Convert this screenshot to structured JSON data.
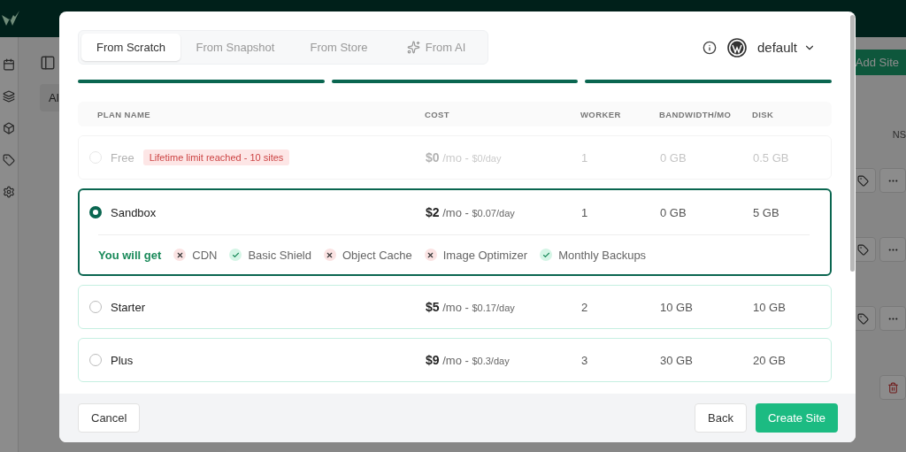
{
  "background": {
    "tab_label": "Al",
    "add_button": "Add Site",
    "column_header": "NS"
  },
  "modal": {
    "tabs": [
      {
        "label": "From Scratch",
        "selected": true
      },
      {
        "label": "From Snapshot",
        "selected": false
      },
      {
        "label": "From Store",
        "selected": false
      },
      {
        "label": "From AI",
        "selected": false
      }
    ],
    "profile": {
      "label": "default"
    },
    "steps": [
      {
        "done": true
      },
      {
        "done": true
      },
      {
        "done": true
      }
    ],
    "columns": [
      "PLAN NAME",
      "COST",
      "WORKER",
      "BANDWIDTH/MO",
      "DISK"
    ],
    "plans": [
      {
        "name": "Free",
        "disabled": true,
        "selected": false,
        "badge": "Lifetime limit reached - 10 sites",
        "price": "$0",
        "per": "/mo -",
        "daily": "$0/day",
        "worker": "1",
        "bandwidth": "0 GB",
        "disk": "0.5 GB"
      },
      {
        "name": "Sandbox",
        "disabled": false,
        "selected": true,
        "price": "$2",
        "per": "/mo -",
        "daily": "$0.07/day",
        "worker": "1",
        "bandwidth": "0 GB",
        "disk": "5 GB",
        "features_title": "You will get",
        "features": [
          {
            "label": "CDN",
            "included": false
          },
          {
            "label": "Basic Shield",
            "included": true
          },
          {
            "label": "Object Cache",
            "included": false
          },
          {
            "label": "Image Optimizer",
            "included": false
          },
          {
            "label": "Monthly Backups",
            "included": true
          }
        ]
      },
      {
        "name": "Starter",
        "disabled": false,
        "selected": false,
        "price": "$5",
        "per": "/mo -",
        "daily": "$0.17/day",
        "worker": "2",
        "bandwidth": "10 GB",
        "disk": "10 GB"
      },
      {
        "name": "Plus",
        "disabled": false,
        "selected": false,
        "price": "$9",
        "per": "/mo -",
        "daily": "$0.3/day",
        "worker": "3",
        "bandwidth": "30 GB",
        "disk": "20 GB"
      }
    ],
    "footer": {
      "cancel": "Cancel",
      "back": "Back",
      "create": "Create Site"
    }
  }
}
